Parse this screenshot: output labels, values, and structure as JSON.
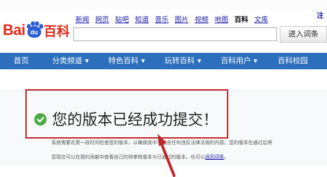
{
  "header": {
    "logo": {
      "text_left": "Bai",
      "paw_text": "du",
      "text_right": "百科"
    },
    "links": [
      "新闻",
      "网页",
      "贴吧",
      "知道",
      "音乐",
      "图片",
      "视频",
      "地图"
    ],
    "current": "百科",
    "extra_link": "文库",
    "corner_link": "注",
    "search": {
      "value": "",
      "button_label": "进入词条"
    }
  },
  "nav": {
    "items": [
      {
        "label": "首页",
        "has_caret": false
      },
      {
        "label": "分类频道",
        "has_caret": true
      },
      {
        "label": "特色百科",
        "has_caret": true
      },
      {
        "label": "玩转百科",
        "has_caret": true
      },
      {
        "label": "百科用户",
        "has_caret": true
      },
      {
        "label": "百科校园",
        "has_caret": false
      }
    ],
    "caret_symbol": "▼"
  },
  "main": {
    "success_title": "您的版本已经成功提交！",
    "info_line1": "系统需要花费一段时间检查您的版本，以确保其中不包含任何违反法律法规的内容。您的版本在通过后将",
    "info_line2_before": "您现在可以在我的贡献中查看自己的待审核版本与已通过的版本，也可以",
    "info_line2_link": "返回词条",
    "info_line2_after": "。"
  },
  "colors": {
    "brand_red": "#e32a1a",
    "brand_blue": "#2c5fd6",
    "nav_bar": "#2b6fbd",
    "success_green": "#4caa43",
    "annotation_red": "#c0262a"
  },
  "icons": {
    "check": "check-circle-icon",
    "arrow": "annotation-arrow-icon"
  }
}
